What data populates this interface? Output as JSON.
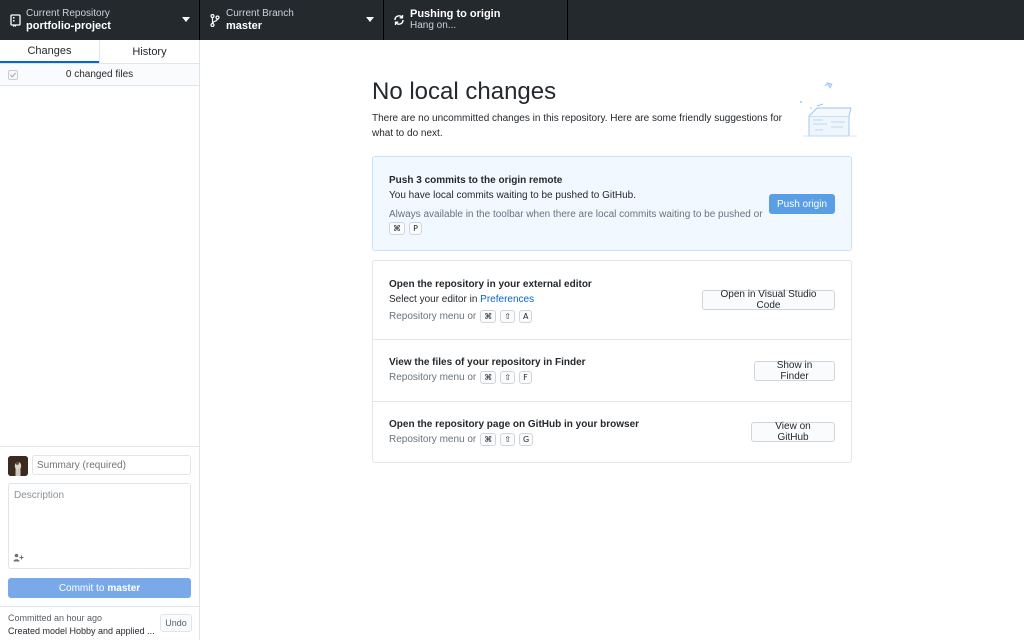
{
  "toolbar": {
    "repository": {
      "title": "Current Repository",
      "value": "portfolio-project",
      "icon": "repo-icon"
    },
    "branch": {
      "title": "Current Branch",
      "value": "master",
      "icon": "branch-icon"
    },
    "push": {
      "title": "Pushing to origin",
      "subtitle": "Hang on...",
      "icon": "sync-icon"
    }
  },
  "sidebar": {
    "tabs": [
      {
        "label": "Changes",
        "active": true
      },
      {
        "label": "History",
        "active": false
      }
    ],
    "changed_files": "0 changed files",
    "commit": {
      "summary_placeholder": "Summary (required)",
      "description_placeholder": "Description",
      "commit_button_prefix": "Commit to",
      "commit_button_branch": "master"
    },
    "last_commit": {
      "time": "Committed an hour ago",
      "message": "Created model Hobby and applied ...",
      "undo_label": "Undo"
    }
  },
  "main": {
    "headline": "No local changes",
    "intro": "There are no uncommitted changes in this repository. Here are some friendly suggestions for what to do next.",
    "push_card": {
      "title": "Push 3 commits to the origin remote",
      "description": "You have local commits waiting to be pushed to GitHub.",
      "hint": "Always available in the toolbar when there are local commits waiting to be pushed or",
      "shortcut": [
        "⌘",
        "P"
      ],
      "button": "Push origin"
    },
    "options": [
      {
        "title": "Open the repository in your external editor",
        "description_prefix": "Select your editor in",
        "description_link": "Preferences",
        "menu_prefix": "Repository menu or",
        "shortcut": [
          "⌘",
          "⇧",
          "A"
        ],
        "button": "Open in Visual Studio Code"
      },
      {
        "title": "View the files of your repository in Finder",
        "menu_prefix": "Repository menu or",
        "shortcut": [
          "⌘",
          "⇧",
          "F"
        ],
        "button": "Show in Finder"
      },
      {
        "title": "Open the repository page on GitHub in your browser",
        "menu_prefix": "Repository menu or",
        "shortcut": [
          "⌘",
          "⇧",
          "G"
        ],
        "button": "View on GitHub"
      }
    ]
  },
  "colors": {
    "toolbar_bg": "#24292e",
    "accent": "#0366d6",
    "primary_button": "#5a9fe6",
    "push_card_bg": "#f1f8ff"
  }
}
